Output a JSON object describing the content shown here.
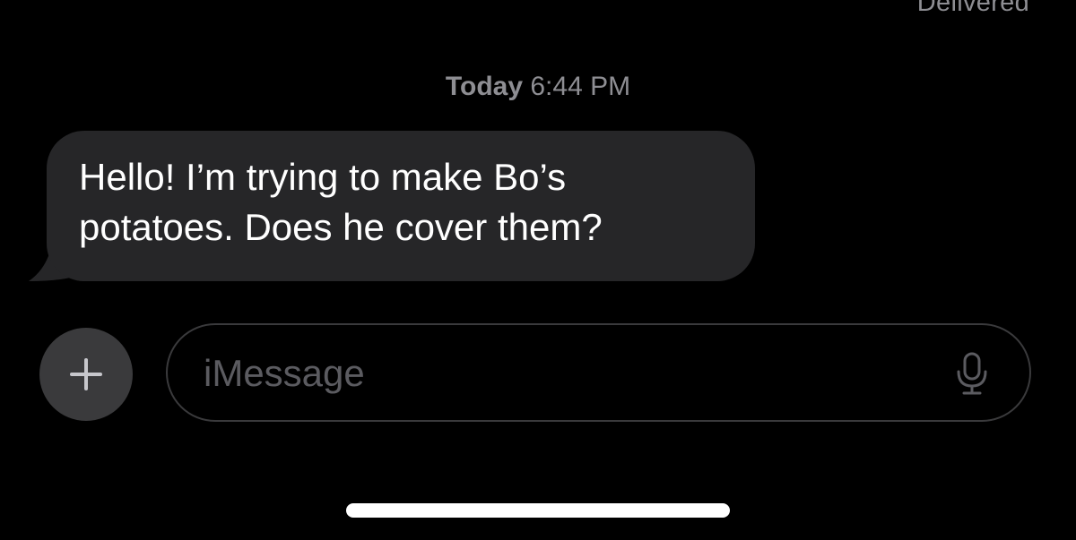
{
  "status": {
    "delivered": "Delivered"
  },
  "timestamp": {
    "day": "Today",
    "time": "6:44 PM"
  },
  "message": {
    "line1": "Hello! I’m trying to make Bo’s",
    "line2": "potatoes. Does he cover them?"
  },
  "composer": {
    "placeholder": "iMessage",
    "add_icon": "plus-icon",
    "mic_icon": "microphone-icon"
  },
  "colors": {
    "background": "#000000",
    "bubble": "#262628",
    "secondary_text": "#8e8e93",
    "input_border": "#3a3a3c"
  }
}
